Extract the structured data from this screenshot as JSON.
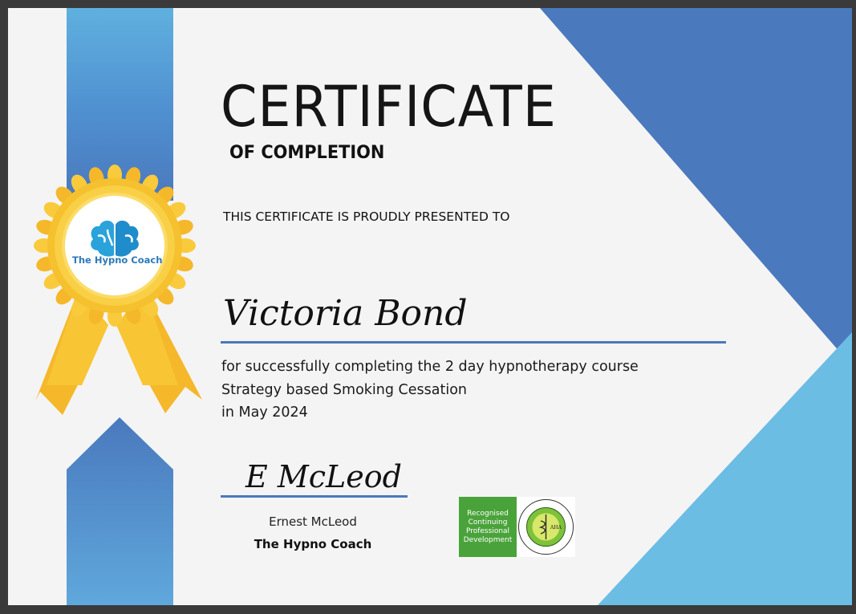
{
  "certificate": {
    "title": "CERTIFICATE",
    "subtitle": "OF COMPLETION",
    "presented_to": "THIS CERTIFICATE IS PROUDLY PRESENTED TO",
    "recipient": "Victoria Bond",
    "description_lines": [
      "for successfully completing the 2 day hypnotherapy course",
      "Strategy based Smoking Cessation",
      "in May 2024"
    ],
    "signature": "E McLeod",
    "signer_name": "Ernest McLeod",
    "organization": "The Hypno Coach"
  },
  "rosette": {
    "logo_text": "The Hypno Coach",
    "logo_icon": "brain-icon"
  },
  "accreditation": {
    "text_lines": [
      "Recognised",
      "Continuing",
      "Professional",
      "Development"
    ],
    "seal_label": "AHA",
    "seal_ring_text": "AUSTRALIAN HYPNOTHERAPISTS ASSOCIATION"
  },
  "colors": {
    "dark_blue": "#4a79bd",
    "light_blue": "#6bbde3",
    "ribbon_blue": "#5aa6d8",
    "gold": "#f6c12e",
    "green": "#4aa33a"
  }
}
